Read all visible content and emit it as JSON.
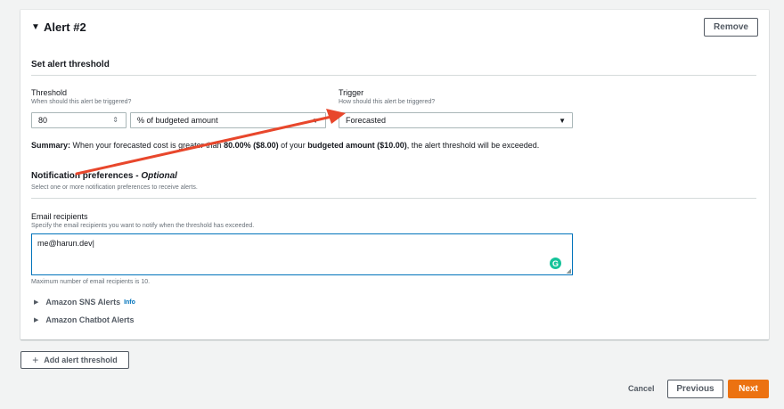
{
  "alert": {
    "title": "Alert #2",
    "remove_label": "Remove"
  },
  "threshold_section": {
    "title": "Set alert threshold",
    "threshold_label": "Threshold",
    "threshold_desc": "When should this alert be triggered?",
    "threshold_value": "80",
    "threshold_unit": "% of budgeted amount",
    "trigger_label": "Trigger",
    "trigger_desc": "How should this alert be triggered?",
    "trigger_value": "Forecasted"
  },
  "summary": {
    "label": "Summary:",
    "part1": " When your forecasted cost is greater than ",
    "pct": "80.00%",
    "amount": " ($8.00)",
    "part2": " of your ",
    "budget": "budgeted amount ($10.00)",
    "part3": ", the alert threshold will be exceeded."
  },
  "notification": {
    "title": "Notification preferences - ",
    "optional": "Optional",
    "desc": "Select one or more notification preferences to receive alerts.",
    "email_label": "Email recipients",
    "email_desc": "Specify the email recipients you want to notify when the threshold has exceeded.",
    "email_value": "me@harun.dev",
    "grammarly_letter": "G",
    "max_note": "Maximum number of email recipients is 10.",
    "sns_label": "Amazon SNS Alerts",
    "sns_info": "Info",
    "chatbot_label": "Amazon Chatbot Alerts"
  },
  "footer": {
    "add_label": "Add alert threshold",
    "cancel_label": "Cancel",
    "previous_label": "Previous",
    "next_label": "Next"
  },
  "colors": {
    "accent": "#ec7211",
    "link": "#0073bb",
    "annotation_arrow": "#e8472c"
  }
}
